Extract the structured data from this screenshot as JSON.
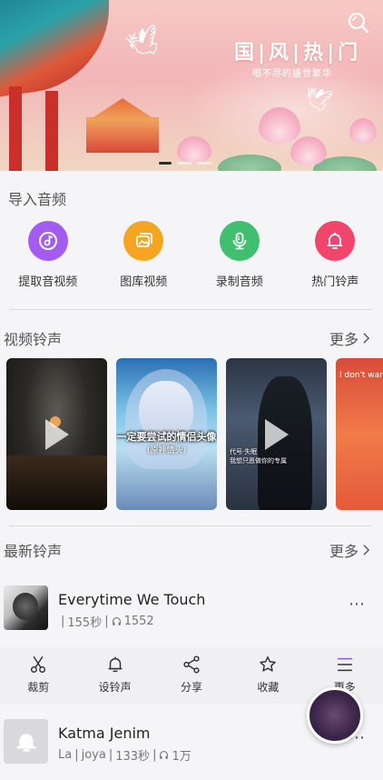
{
  "banner": {
    "title": "国|风|热|门",
    "subtitle": "唱不尽的盛世繁华"
  },
  "import_section": {
    "title": "导入音频",
    "items": [
      {
        "label": "提取音视频",
        "icon": "music-disc-icon",
        "color": "#a35bf0"
      },
      {
        "label": "图库视频",
        "icon": "gallery-icon",
        "color": "#f4a623"
      },
      {
        "label": "录制音频",
        "icon": "microphone-icon",
        "color": "#3fbf6f"
      },
      {
        "label": "热门铃声",
        "icon": "bell-icon",
        "color": "#f2456b"
      }
    ]
  },
  "video_section": {
    "title": "视频铃声",
    "more": "更多",
    "captions": {
      "v2_line1": "一定要尝试的情侣头像",
      "v2_line2": "(原神情头)",
      "v3_line1": "代号·失眠",
      "v3_line2": "我想只愿做你的专属",
      "v4_line1": "I don't wan"
    }
  },
  "latest_section": {
    "title": "最新铃声",
    "more": "更多"
  },
  "ringtones": [
    {
      "title": "Everytime We Touch",
      "artist": "",
      "duration": "155秒",
      "plays": "1552"
    },
    {
      "title": "Katma Jenim",
      "artist": "La",
      "uploader": "joya",
      "duration": "133秒",
      "plays": "1万"
    }
  ],
  "actions": [
    {
      "label": "裁剪",
      "icon": "scissors-icon"
    },
    {
      "label": "设铃声",
      "icon": "bell-icon"
    },
    {
      "label": "分享",
      "icon": "share-icon"
    },
    {
      "label": "收藏",
      "icon": "star-icon"
    },
    {
      "label": "更多",
      "icon": "menu-icon"
    }
  ],
  "colors": {
    "accent_purple": "#a35bf0",
    "accent_orange": "#f4a623",
    "accent_green": "#3fbf6f",
    "accent_pink": "#f2456b"
  }
}
